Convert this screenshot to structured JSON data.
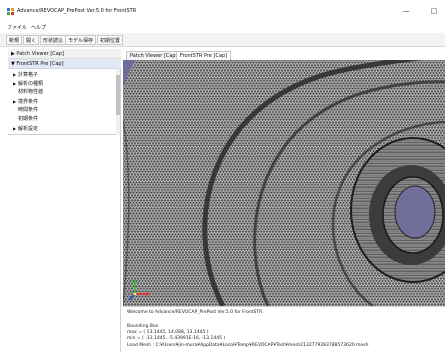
{
  "window": {
    "title": "Advance/REVOCAP_PrePost Ver.5.0 for FrontSTR",
    "minimize_label": "—",
    "maximize_label": "□"
  },
  "menu": [
    "ファイル",
    "ヘルプ"
  ],
  "toolbar": [
    "新規",
    "開く",
    "形状読込",
    "モデル保存",
    "初期位置"
  ],
  "tree": {
    "header1": "▶ Patch Viewer [Cap]",
    "header2": "▼ FrontSTR Pre [Cap]",
    "items": [
      {
        "label": "計算格子",
        "arrow": "▶"
      },
      {
        "label": "解析の種類",
        "arrow": "▶"
      },
      {
        "label": "材料物性値",
        "arrow": ""
      },
      {
        "label": "境界条件",
        "arrow": "▶"
      },
      {
        "label": "時間条件",
        "arrow": ""
      },
      {
        "label": "初期条件",
        "arrow": ""
      },
      {
        "label": "解析設定",
        "arrow": "▶"
      }
    ]
  },
  "tabs": [
    "Patch Viewer [Cap]",
    "FrontSTR Pre [Cap]"
  ],
  "console": {
    "lines": [
      "Welcome to Advance/REVOCAP_PrePost Ver.5.0 for FrontSTR.",
      "",
      "Bounding Box",
      "  max = ( 13.1445, 14.088, 13.1445 )",
      "  min = ( -13.1445, -5.43991E-16, -13.1445 )",
      "Load Mesh : C:¥Users¥jin-mura¥AppData¥Local¥Temp¥REVOCAP¥Test¥mesh2132779283788573620.mesh"
    ]
  },
  "colors": {
    "viewport_bg": "#4c4c4c",
    "mesh_fill": "#d2d2d2",
    "bore_fill": "#6f6f99",
    "corner_fill": "#6d6d9c",
    "tab_active": "#ffffff",
    "tree_selected": "#e3e9f4"
  }
}
